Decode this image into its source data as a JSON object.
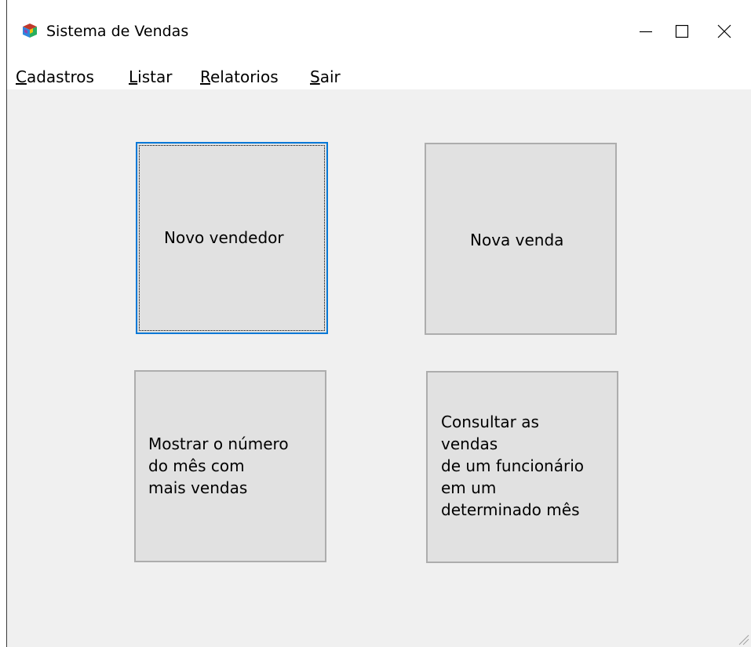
{
  "window": {
    "title": "Sistema de Vendas",
    "icon": "cube-icon"
  },
  "menu": {
    "items": [
      {
        "accel": "C",
        "rest": "adastros"
      },
      {
        "accel": "L",
        "rest": "istar"
      },
      {
        "accel": "R",
        "rest": "elatorios"
      },
      {
        "accel": "S",
        "rest": "air"
      }
    ]
  },
  "buttons": {
    "novo_vendedor": "Novo vendedor",
    "nova_venda": "Nova venda",
    "mostrar_mes": "Mostrar o número\ndo mês com\nmais vendas",
    "consultar": "Consultar as\nvendas\nde um funcionário\nem um\ndeterminado mês"
  },
  "colors": {
    "focus_border": "#0078d7",
    "button_face": "#e1e1e1",
    "client_background": "#f0f0f0"
  }
}
